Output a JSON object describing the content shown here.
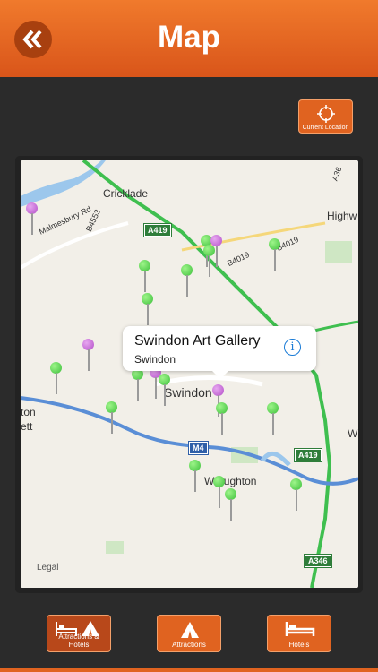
{
  "header": {
    "title": "Map",
    "back_icon": "double-chevron-left-icon"
  },
  "current_location": {
    "label": "Current Location",
    "icon": "crosshair-icon"
  },
  "map": {
    "places": [
      "Cricklade",
      "Highw",
      "Swindon",
      "Wroughton",
      "ton",
      "ett",
      "W",
      "Malmesbury Rd",
      "B4553",
      "B4019",
      "B4019",
      "A36"
    ],
    "roads": [
      "A419",
      "A419",
      "M4",
      "A346"
    ],
    "legal": "Legal",
    "callout": {
      "title": "Swindon Art Gallery",
      "subtitle": "Swindon",
      "info_icon": "info-icon"
    }
  },
  "tabs": [
    {
      "label": "Attractions & Hotels",
      "icon": "bed-and-tent-icon"
    },
    {
      "label": "Attractions",
      "icon": "tent-icon"
    },
    {
      "label": "Hotels",
      "icon": "bed-icon"
    }
  ],
  "colors": {
    "accent": "#e06320",
    "header": "#f07a2c",
    "background": "#2b2b2b",
    "pin_green": "#3cbf3a",
    "pin_purple": "#b34ec8"
  }
}
